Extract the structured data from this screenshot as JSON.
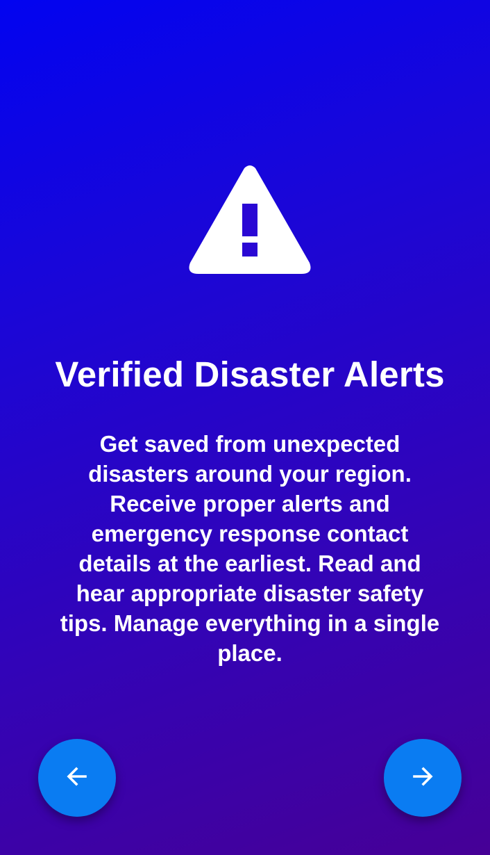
{
  "onboarding": {
    "icon": "warning-icon",
    "title": "Verified Disaster Alerts",
    "description": "Get saved from unexpected disasters around your region. Receive proper alerts and emergency response contact details at the earliest. Read and hear appropriate disaster safety tips. Manage everything in a single place."
  },
  "navigation": {
    "back_icon": "arrow-left-icon",
    "next_icon": "arrow-right-icon"
  },
  "colors": {
    "gradient_start": "#0204f0",
    "gradient_end": "#460096",
    "fab": "#0a7cf2",
    "text": "#ffffff"
  }
}
